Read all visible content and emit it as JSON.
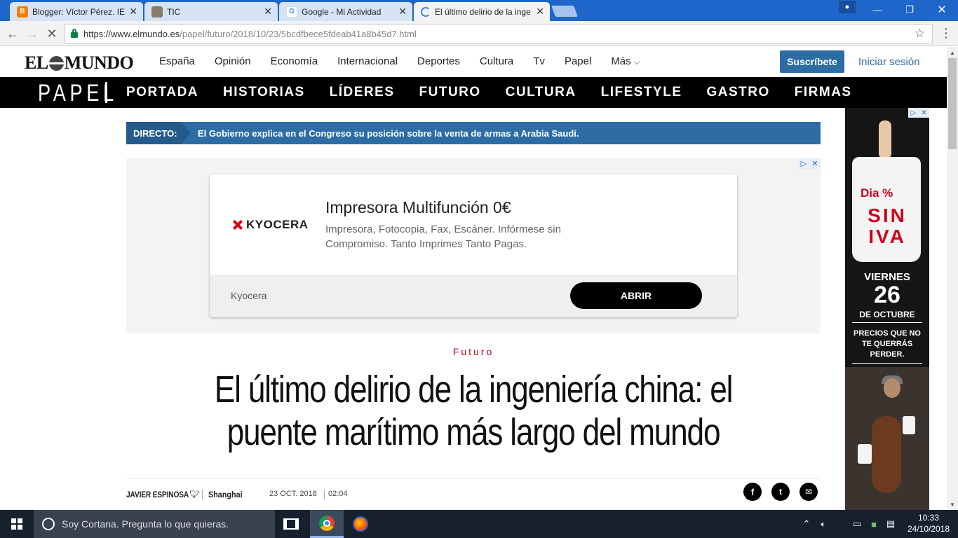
{
  "browser": {
    "tabs": [
      {
        "title": "Blogger: Víctor Pérez. IES",
        "favicon": "blogger-icon",
        "fav_color": "#f57d00",
        "fav_text": "B"
      },
      {
        "title": "TIC",
        "favicon": "portrait-icon",
        "fav_color": "#8a7a6a",
        "fav_text": ""
      },
      {
        "title": "Google - Mi Actividad",
        "favicon": "google-icon",
        "fav_color": "#ffffff",
        "fav_text": "G"
      },
      {
        "title": "El último delirio de la inge",
        "favicon": "loading-spinner-icon",
        "fav_color": "#f2f2f2",
        "fav_text": ""
      }
    ],
    "url_host": "https://www.elmundo.es",
    "url_path": "/papel/futuro/2018/10/23/5bcdfbece5fdeab41a8b45d7.html"
  },
  "site": {
    "logo_left": "EL",
    "logo_right": "MUNDO",
    "nav": [
      "España",
      "Opinión",
      "Economía",
      "Internacional",
      "Deportes",
      "Cultura",
      "Tv",
      "Papel",
      "Más"
    ],
    "subscribe_label": "Suscríbete",
    "login_label": "Iniciar sesión",
    "papel_logo": "PAPEL",
    "sections": [
      "PORTADA",
      "HISTORIAS",
      "LÍDERES",
      "FUTURO",
      "CULTURA",
      "LIFESTYLE",
      "GASTRO",
      "FIRMAS"
    ],
    "accent_color": "#2e6da4"
  },
  "directo": {
    "label": "DIRECTO:",
    "text": "El Gobierno explica en el Congreso su posición sobre la venta de armas a Arabia Saudí."
  },
  "ad": {
    "logo_text": "KYOCERA",
    "title": "Impresora Multifunción 0€",
    "description": "Impresora, Fotocopia, Fax, Escáner. Infórmese sin Compromiso. Tanto Imprimes Tanto Pagas.",
    "brand": "Kyocera",
    "cta": "ABRIR"
  },
  "article": {
    "kicker": "Futuro",
    "headline": "El último delirio de la ingeniería china: el puente marítimo más largo del mundo",
    "author": "JAVIER ESPINOSA",
    "location": "Shanghai",
    "date": "23 OCT. 2018",
    "time": "02:04"
  },
  "skyscraper": {
    "brand": "Dia %",
    "bag_line1": "SIN",
    "bag_line2": "IVA",
    "day_name": "VIERNES",
    "day_num": "26",
    "month": "DE OCTUBRE",
    "promo": "PRECIOS QUE NO TE QUERRÁS PERDER."
  },
  "taskbar": {
    "cortana_text": "Soy Cortana. Pregunta lo que quieras.",
    "time": "10:33",
    "date": "24/10/2018"
  }
}
